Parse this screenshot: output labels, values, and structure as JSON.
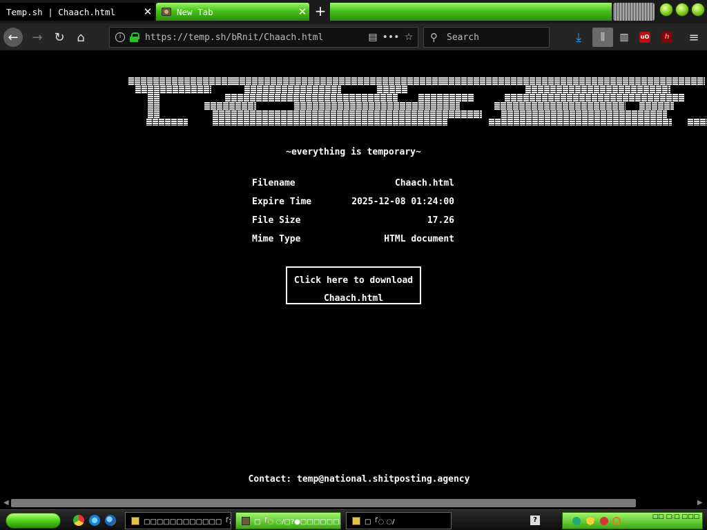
{
  "browser": {
    "tabs": [
      {
        "title": "Temp.sh | Chaach.html",
        "active": true
      },
      {
        "title": "New Tab",
        "active": false
      }
    ],
    "url": "https://temp.sh/bRnit/Chaach.html",
    "search_placeholder": "Search"
  },
  "page": {
    "tagline": "~everything is temporary~",
    "info": [
      {
        "label": "Filename",
        "value": "Chaach.html"
      },
      {
        "label": "Expire Time",
        "value": "2025-12-08 01:24:00"
      },
      {
        "label": "File Size",
        "value": "17.26"
      },
      {
        "label": "Mime Type",
        "value": "HTML document"
      }
    ],
    "download_line1": "Click here to download",
    "download_line2": "Chaach.html",
    "contact_label": "Contact:",
    "contact_email": "temp@national.shitposting.agency"
  },
  "taskbar": {
    "tasks": [
      "□□□□□□□□□□□□「?□□□",
      "□「◌ ◌/□?●□□□□□□□",
      "□「◌ ◌/"
    ],
    "clock": "□□ □:□ □□□"
  },
  "colors": {
    "accent_green": "#49c21a",
    "background": "#000000",
    "text": "#ffffff",
    "lock_green": "#27c227",
    "download_blue": "#2f9bff"
  }
}
